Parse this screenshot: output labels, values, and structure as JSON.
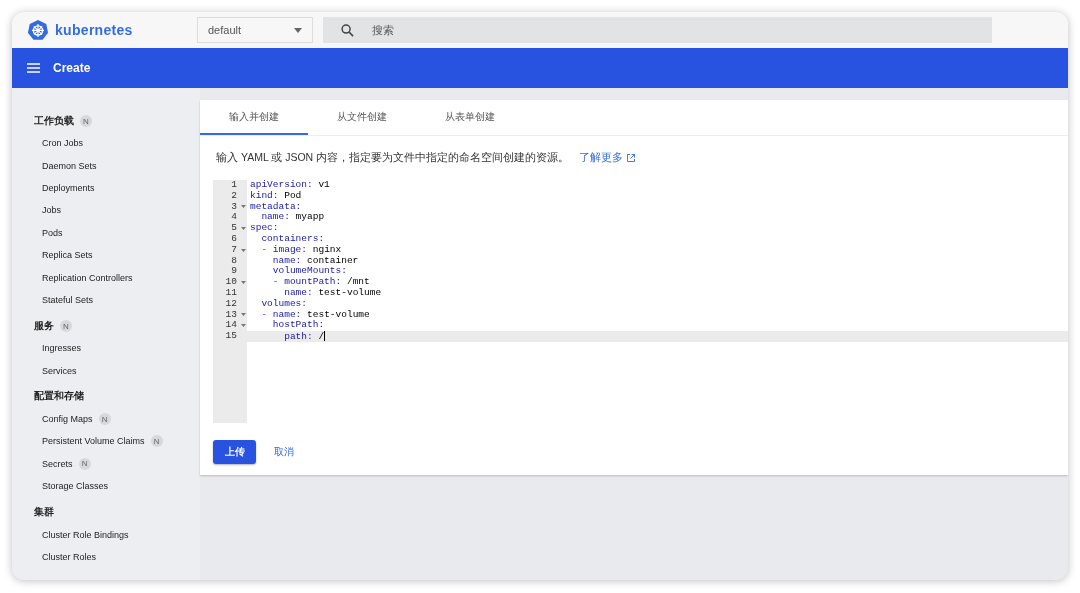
{
  "header": {
    "logo": "kubernetes",
    "namespace": "default",
    "search": {
      "placeholder": "搜索"
    }
  },
  "toolbar": {
    "title": "Create"
  },
  "sidebar": {
    "sections": [
      {
        "title": "工作负载",
        "badge": "N",
        "items": [
          {
            "label": "Cron Jobs"
          },
          {
            "label": "Daemon Sets"
          },
          {
            "label": "Deployments"
          },
          {
            "label": "Jobs"
          },
          {
            "label": "Pods"
          },
          {
            "label": "Replica Sets"
          },
          {
            "label": "Replication Controllers"
          },
          {
            "label": "Stateful Sets"
          }
        ]
      },
      {
        "title": "服务",
        "badge": "N",
        "items": [
          {
            "label": "Ingresses"
          },
          {
            "label": "Services"
          }
        ]
      },
      {
        "title": "配置和存储",
        "items": [
          {
            "label": "Config Maps",
            "badge": "N"
          },
          {
            "label": "Persistent Volume Claims",
            "badge": "N"
          },
          {
            "label": "Secrets",
            "badge": "N"
          },
          {
            "label": "Storage Classes"
          }
        ]
      },
      {
        "title": "集群",
        "items": [
          {
            "label": "Cluster Role Bindings"
          },
          {
            "label": "Cluster Roles"
          }
        ]
      }
    ]
  },
  "tabs": [
    {
      "label": "输入并创建",
      "selected": true
    },
    {
      "label": "从文件创建",
      "selected": false
    },
    {
      "label": "从表单创建",
      "selected": false
    }
  ],
  "description": "输入 YAML 或 JSON 内容，指定要为文件中指定的命名空间创建的资源。",
  "learn_more": "了解更多",
  "editor": {
    "lines": [
      {
        "number": "1",
        "fold": false,
        "current": false,
        "tokens": [
          {
            "kind": "key",
            "text": "apiVersion:"
          },
          {
            "kind": "value",
            "text": " v1"
          }
        ]
      },
      {
        "number": "2",
        "fold": false,
        "current": false,
        "tokens": [
          {
            "kind": "key",
            "text": "kind:"
          },
          {
            "kind": "value",
            "text": " Pod"
          }
        ]
      },
      {
        "number": "3",
        "fold": true,
        "current": false,
        "tokens": [
          {
            "kind": "key",
            "text": "metadata:"
          }
        ]
      },
      {
        "number": "4",
        "fold": false,
        "current": false,
        "tokens": [
          {
            "kind": "key",
            "text": "  name:"
          },
          {
            "kind": "value",
            "text": " myapp"
          }
        ]
      },
      {
        "number": "5",
        "fold": true,
        "current": false,
        "tokens": [
          {
            "kind": "key",
            "text": "spec:"
          }
        ]
      },
      {
        "number": "6",
        "fold": false,
        "current": false,
        "tokens": [
          {
            "kind": "key",
            "text": "  containers:"
          }
        ]
      },
      {
        "number": "7",
        "fold": true,
        "current": false,
        "tokens": [
          {
            "kind": "dash",
            "text": "  -"
          },
          {
            "kind": "key",
            "text": " image:"
          },
          {
            "kind": "value",
            "text": " nginx"
          }
        ]
      },
      {
        "number": "8",
        "fold": false,
        "current": false,
        "tokens": [
          {
            "kind": "key",
            "text": "    name:"
          },
          {
            "kind": "value",
            "text": " container"
          }
        ]
      },
      {
        "number": "9",
        "fold": false,
        "current": false,
        "tokens": [
          {
            "kind": "key",
            "text": "    volumeMounts:"
          }
        ]
      },
      {
        "number": "10",
        "fold": true,
        "current": false,
        "tokens": [
          {
            "kind": "dash",
            "text": "    -"
          },
          {
            "kind": "key",
            "text": " mountPath:"
          },
          {
            "kind": "value",
            "text": " /mnt"
          }
        ]
      },
      {
        "number": "11",
        "fold": false,
        "current": false,
        "tokens": [
          {
            "kind": "key",
            "text": "      name:"
          },
          {
            "kind": "value",
            "text": " test-volume"
          }
        ]
      },
      {
        "number": "12",
        "fold": false,
        "current": false,
        "tokens": [
          {
            "kind": "key",
            "text": "  volumes:"
          }
        ]
      },
      {
        "number": "13",
        "fold": true,
        "current": false,
        "tokens": [
          {
            "kind": "dash",
            "text": "  -"
          },
          {
            "kind": "key",
            "text": " name:"
          },
          {
            "kind": "value",
            "text": " test-volume"
          }
        ]
      },
      {
        "number": "14",
        "fold": true,
        "current": false,
        "tokens": [
          {
            "kind": "key",
            "text": "    hostPath:"
          }
        ]
      },
      {
        "number": "15",
        "fold": false,
        "current": true,
        "tokens": [
          {
            "kind": "key",
            "text": "      path:"
          },
          {
            "kind": "value",
            "text": " /"
          }
        ]
      }
    ]
  },
  "buttons": {
    "upload": "上传",
    "cancel": "取消"
  }
}
